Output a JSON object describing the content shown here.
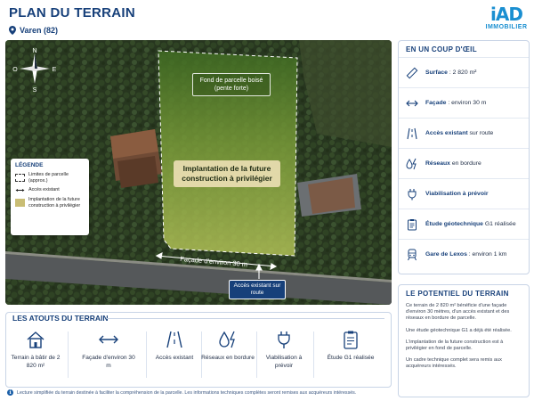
{
  "header": {
    "title": "PLAN DU TERRAIN",
    "location": "Varen (82)",
    "logo_mark": "iAD",
    "logo_sub": "IMMOBILIER"
  },
  "map": {
    "compass": {
      "n": "N",
      "e": "E",
      "s": "S",
      "w": "O"
    },
    "zone_label": "Fond de parcelle boisé (pente forte)",
    "build_label": "Implantation de la future construction à privilégier",
    "facade_label": "Façade d'environ 30 m",
    "access_label": "Accès existant sur route",
    "legend": {
      "title": "LÉGENDE",
      "items": [
        {
          "icon": "dashed-boundary-icon",
          "text": "Limites de parcelle (approx.)"
        },
        {
          "icon": "double-arrow-icon",
          "text": "Accès existant"
        },
        {
          "icon": "build-zone-swatch-icon",
          "text": "Implantation de la future construction à privilégier"
        }
      ]
    }
  },
  "glance": {
    "title": "EN UN COUP D'ŒIL",
    "items": [
      {
        "icon": "ruler-icon",
        "label": "Surface",
        "value": " : 2 820 m²"
      },
      {
        "icon": "double-arrow-icon",
        "label": "Façade",
        "value": " : environ 30 m"
      },
      {
        "icon": "road-icon",
        "label": "Accès existant",
        "value": " sur route"
      },
      {
        "icon": "utilities-icon",
        "label": "Réseaux",
        "value": " en bordure"
      },
      {
        "icon": "plug-icon",
        "label": "Viabilisation à prévoir",
        "value": ""
      },
      {
        "icon": "clipboard-icon",
        "label": "Étude géotechnique",
        "value": " G1 réalisée"
      },
      {
        "icon": "train-icon",
        "label": "Gare de Lexos",
        "value": " : environ 1 km"
      }
    ]
  },
  "potentiel": {
    "title": "LE POTENTIEL DU TERRAIN",
    "paragraphs": [
      "Ce terrain de 2 820 m² bénéficie d'une façade d'environ 30 mètres, d'un accès existant et des réseaux en bordure de parcelle.",
      "Une étude géotechnique G1 a déjà été réalisée.",
      "L'implantation de la future construction est à privilégier en fond de parcelle.",
      "Un cadre technique complet sera remis aux acquéreurs intéressés."
    ]
  },
  "atouts": {
    "title": "LES ATOUTS DU TERRAIN",
    "items": [
      {
        "icon": "house-icon",
        "label": "Terrain à bâtir de 2 820 m²"
      },
      {
        "icon": "double-arrow-icon",
        "label": "Façade d'environ 30 m"
      },
      {
        "icon": "road-icon",
        "label": "Accès existant"
      },
      {
        "icon": "utilities-icon",
        "label": "Réseaux en bordure"
      },
      {
        "icon": "plug-icon",
        "label": "Viabilisation à prévoir"
      },
      {
        "icon": "clipboard-icon",
        "label": "Étude G1 réalisée"
      }
    ]
  },
  "footnote": "Lecture simplifiée du terrain destinée à faciliter la compréhension de la parcelle. Les informations techniques complètes seront remises aux acquéreurs intéressés.",
  "colors": {
    "primary": "#17407a",
    "accent": "#1a8fd1",
    "zone": "#c9d96a"
  }
}
